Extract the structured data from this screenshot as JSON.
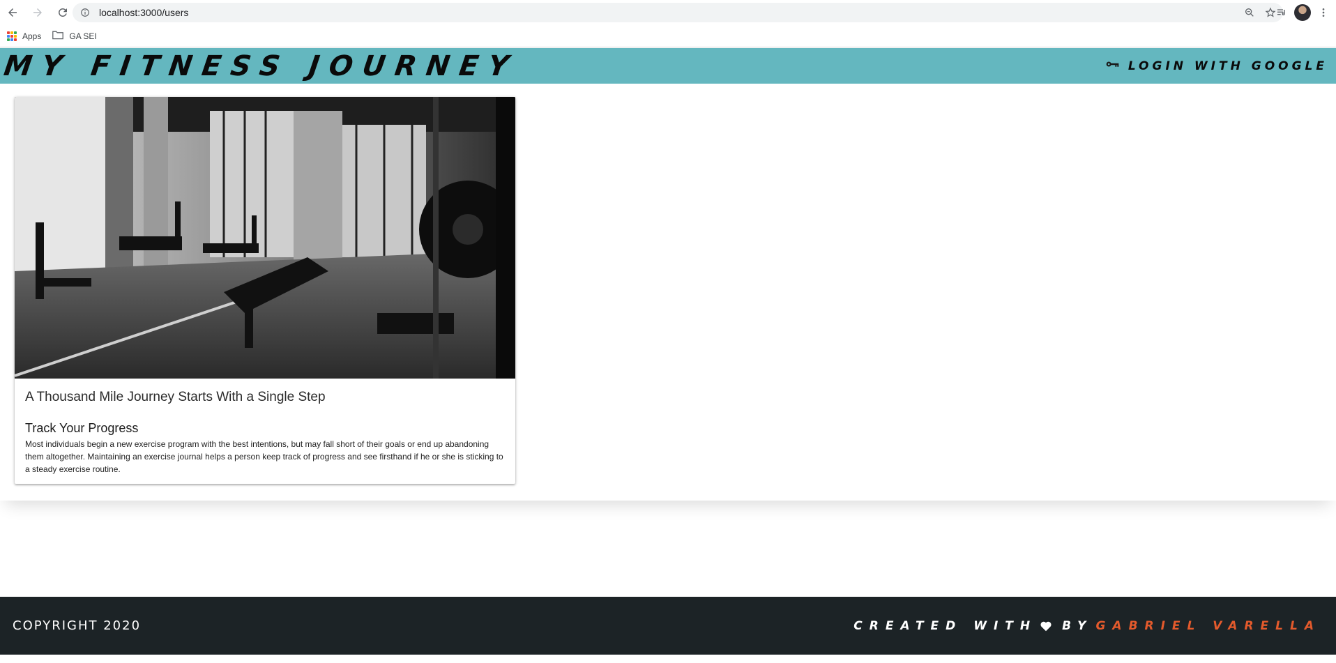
{
  "browser": {
    "url": "localhost:3000/users",
    "bookmarks": [
      {
        "label": "Apps",
        "icon": "apps-grid-icon"
      },
      {
        "label": "GA SEI",
        "icon": "folder-icon"
      }
    ]
  },
  "header": {
    "brand": "My Fitness Journey",
    "login_label": "Login with Google",
    "login_icon": "key-icon",
    "background_color": "#64b7bf"
  },
  "card": {
    "image_description_icon": "gym-photo",
    "title": "A Thousand Mile Journey Starts With a Single Step",
    "subtitle": "Track Your Progress",
    "body": "Most individuals begin a new exercise program with the best intentions, but may fall short of their goals or end up abandoning them altogether. Maintaining an exercise journal helps a person keep track of progress and see firsthand if he or she is sticking to a steady exercise routine."
  },
  "footer": {
    "copyright": "COPYRIGHT 2020",
    "created_with": "Created with",
    "heart_icon": "heart-icon",
    "by": "by",
    "author": "Gabriel Varella",
    "background_color": "#1c2326",
    "author_color": "#e45a2c"
  }
}
